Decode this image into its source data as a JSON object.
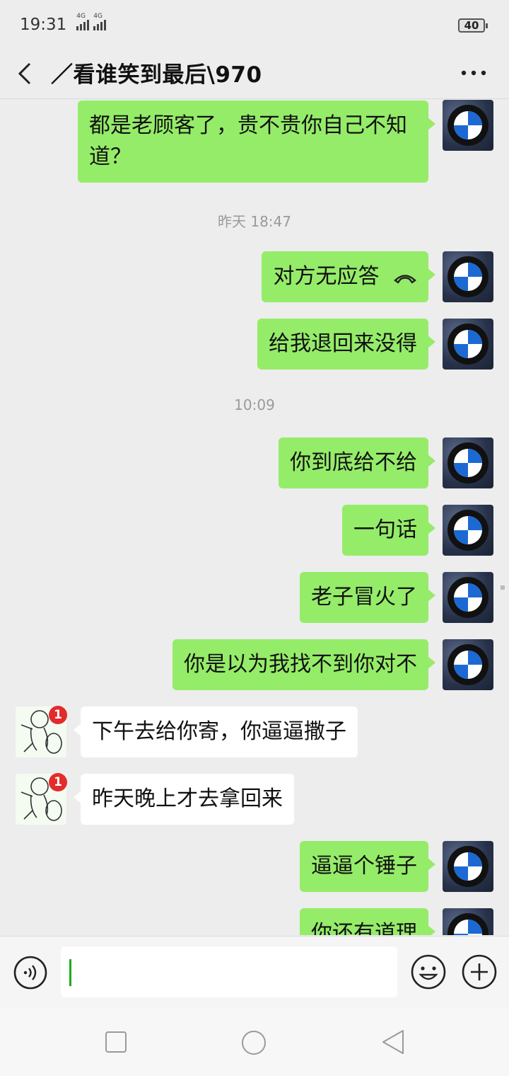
{
  "status_bar": {
    "time": "19:31",
    "signal_1": "4G",
    "signal_2": "4G",
    "battery": "40"
  },
  "header": {
    "title": "／看谁笑到最后\\970"
  },
  "messages": [
    {
      "text_line1": "都是老顾客了，贵不贵你自己不知",
      "text_line2": "道？"
    },
    {
      "timestamp": "昨天 18:47"
    },
    {
      "text": "对方无应答"
    },
    {
      "text": "给我退回来没得"
    },
    {
      "timestamp": "10:09"
    },
    {
      "text": "你到底给不给"
    },
    {
      "text": "一句话"
    },
    {
      "text": "老子冒火了"
    },
    {
      "text": "你是以为我找不到你对不"
    },
    {
      "text": "下午去给你寄，你逼逼撒子",
      "badge": "1"
    },
    {
      "text": "昨天晚上才去拿回来",
      "badge": "1"
    },
    {
      "text": "逼逼个锤子"
    },
    {
      "text": "你还有道理"
    }
  ],
  "input": {
    "value": ""
  },
  "icons": {
    "back": "back-chevron-icon",
    "more": "more-dots-icon",
    "voice": "voice-icon",
    "emoji": "emoji-icon",
    "plus": "plus-icon",
    "call": "phone-hangup-icon"
  },
  "colors": {
    "outgoing_bubble": "#95ec69",
    "incoming_bubble": "#ffffff",
    "badge": "#e32b2b",
    "background": "#ededed"
  }
}
